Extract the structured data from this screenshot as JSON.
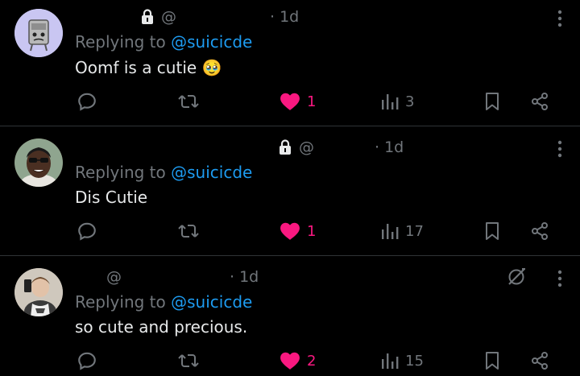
{
  "tweets": [
    {
      "at": "@",
      "time": "· 1d",
      "replying_prefix": "Replying to",
      "replying_handle": "@suicicde",
      "text": "Oomf is a cutie 🥹",
      "likes": "1",
      "views": "3",
      "liked": true,
      "locked": true
    },
    {
      "at": "@",
      "time": "· 1d",
      "replying_prefix": "Replying to",
      "replying_handle": "@suicicde",
      "text": "Dis Cutie",
      "likes": "1",
      "views": "17",
      "liked": true,
      "locked": true
    },
    {
      "at": "@",
      "time": "· 1d",
      "replying_prefix": "Replying to",
      "replying_handle": "@suicicde",
      "text": "so cute and precious.",
      "likes": "2",
      "views": "15",
      "liked": true,
      "locked": false
    }
  ],
  "colors": {
    "background": "#000000",
    "text": "#e7e9ea",
    "muted": "#71767b",
    "link": "#1d9bf0",
    "like": "#f91880",
    "divider": "#2f3336"
  }
}
